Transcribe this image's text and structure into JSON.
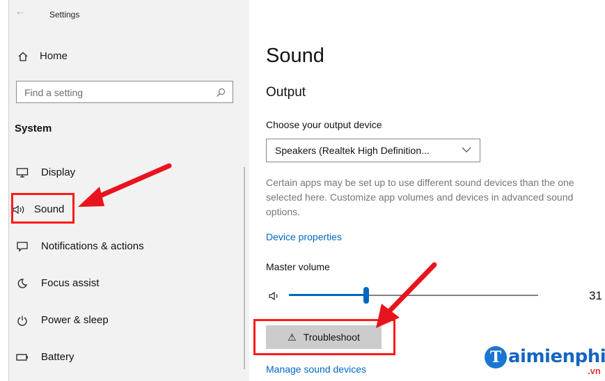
{
  "window": {
    "title": "Settings",
    "back_icon": "back-arrow-icon"
  },
  "sidebar": {
    "home_label": "Home",
    "search_placeholder": "Find a setting",
    "section_label": "System",
    "items": [
      {
        "label": "Display",
        "icon": "monitor-icon"
      },
      {
        "label": "Sound",
        "icon": "speaker-icon"
      },
      {
        "label": "Notifications & actions",
        "icon": "notification-icon"
      },
      {
        "label": "Focus assist",
        "icon": "moon-icon"
      },
      {
        "label": "Power & sleep",
        "icon": "power-icon"
      },
      {
        "label": "Battery",
        "icon": "battery-icon"
      }
    ]
  },
  "main": {
    "title": "Sound",
    "output_heading": "Output",
    "choose_label": "Choose your output device",
    "output_device": "Speakers (Realtek High Definition...",
    "description": "Certain apps may be set up to use different sound devices than the one selected here. Customize app volumes and devices in advanced sound options.",
    "device_properties_link": "Device properties",
    "master_volume_label": "Master volume",
    "volume_value": "31",
    "volume_level_percent": 31,
    "troubleshoot_label": "Troubleshoot",
    "manage_link": "Manage sound devices"
  },
  "watermark": {
    "brand": "aimienphi",
    "brand_initial": "T",
    "suffix": ".vn"
  },
  "colors": {
    "accent": "#0067c0",
    "highlight": "#ff1a1a",
    "sidebar_bg": "#f2f2f2"
  }
}
